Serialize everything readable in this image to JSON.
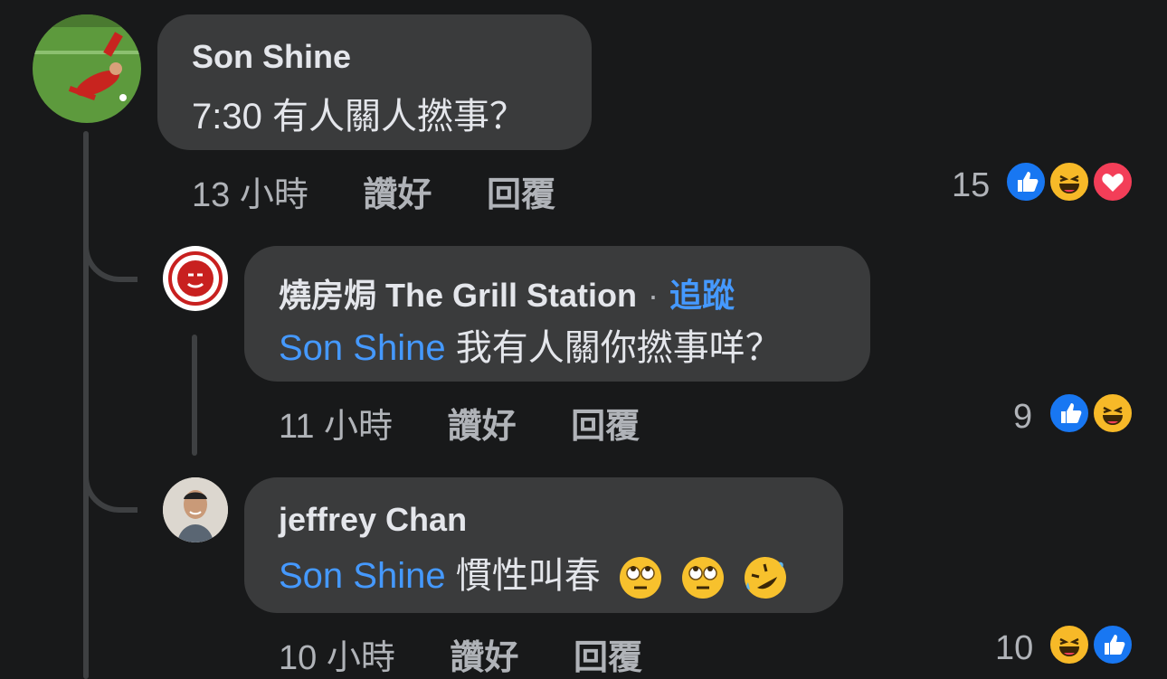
{
  "comments": [
    {
      "author": "Son Shine",
      "text": "7:30 有人關人撚事？",
      "time": "13 小時",
      "like_label": "讚好",
      "reply_label": "回覆",
      "reaction_count": "15",
      "reactions": [
        "like-icon",
        "haha-icon",
        "love-icon"
      ]
    },
    {
      "author": "燒房焗 The Grill Station",
      "separator": "·",
      "follow_label": "追蹤",
      "mention": "Son Shine",
      "text": "我有人關你撚事咩？",
      "time": "11 小時",
      "like_label": "讚好",
      "reply_label": "回覆",
      "reaction_count": "9",
      "reactions": [
        "like-icon",
        "haha-icon"
      ]
    },
    {
      "author": "jeffrey Chan",
      "mention": "Son Shine",
      "text": "慣性叫春",
      "inline_emojis": [
        "eye-roll-emoji-icon",
        "eye-roll-emoji-icon",
        "rofl-emoji-icon"
      ],
      "time": "10 小時",
      "like_label": "讚好",
      "reply_label": "回覆",
      "reaction_count": "10",
      "reactions": [
        "haha-icon",
        "like-icon"
      ]
    }
  ],
  "colors": {
    "background": "#18191a",
    "bubble": "#3a3b3c",
    "mention": "#4599ff",
    "like": "#1877f2",
    "haha": "#f7b928",
    "love": "#f33e58"
  }
}
